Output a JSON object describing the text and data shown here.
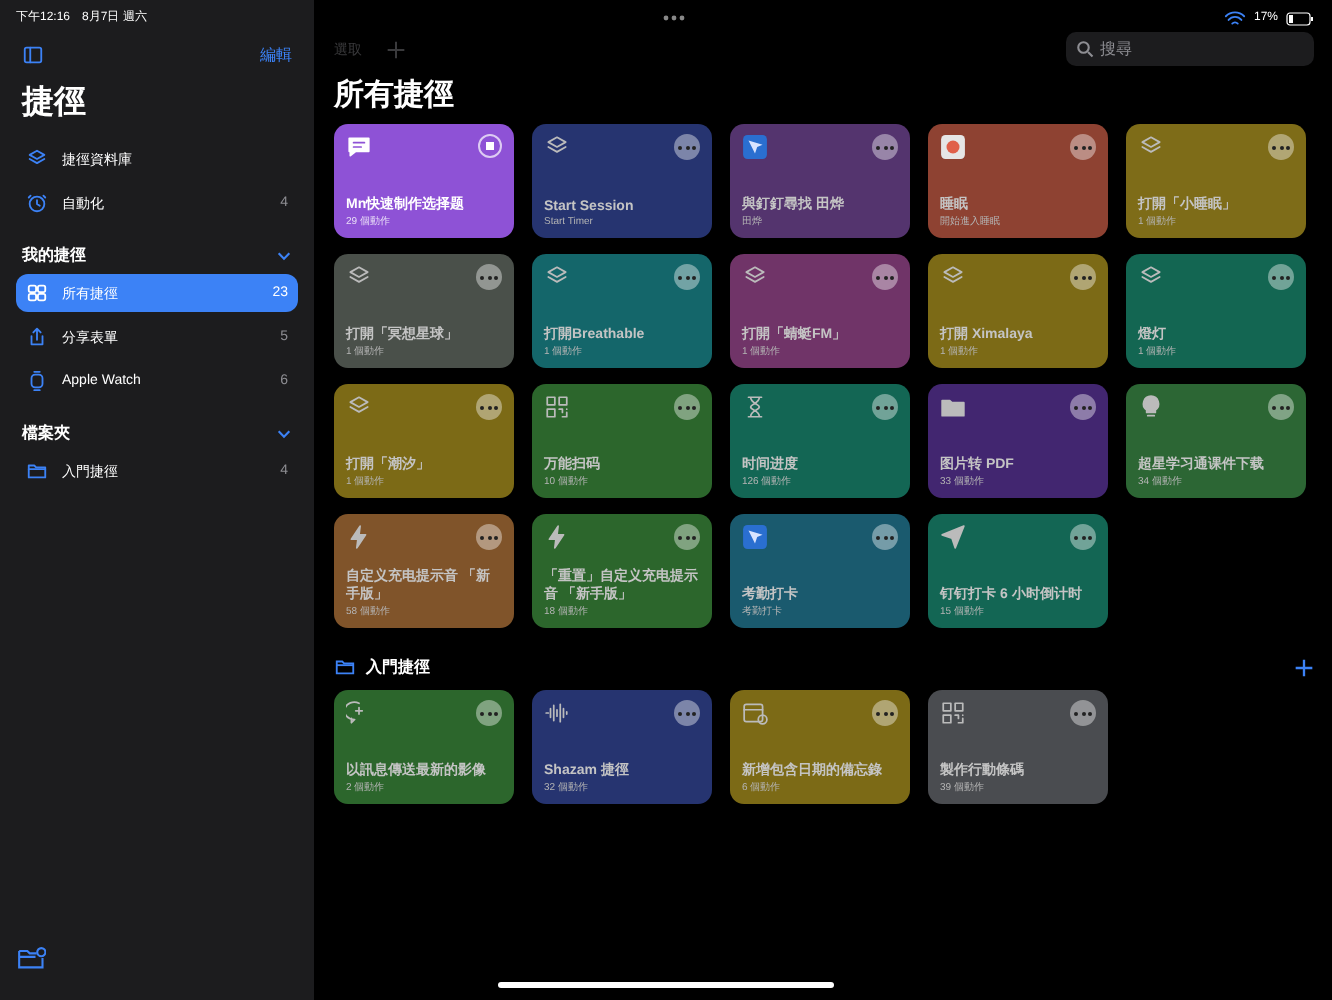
{
  "status_bar": {
    "time": "下午12:16",
    "date": "8月7日 週六",
    "battery": "17%"
  },
  "sidebar": {
    "edit": "編輯",
    "title": "捷徑",
    "top_items": [
      {
        "kind": "gallery",
        "label": "捷徑資料庫",
        "selected": false
      },
      {
        "kind": "automation",
        "label": "自動化",
        "count": "4",
        "selected": false
      }
    ],
    "sections": [
      {
        "title": "我的捷徑",
        "expanded": true,
        "items": [
          {
            "kind": "grid",
            "label": "所有捷徑",
            "count": "23",
            "selected": true
          },
          {
            "kind": "share",
            "label": "分享表單",
            "count": "5",
            "selected": false
          },
          {
            "kind": "watch",
            "label": "Apple Watch",
            "count": "6",
            "selected": false
          }
        ]
      },
      {
        "title": "檔案夾",
        "expanded": true,
        "items": [
          {
            "kind": "folder",
            "label": "入門捷徑",
            "count": "4",
            "selected": false
          }
        ]
      }
    ]
  },
  "toolbar": {
    "select": "選取",
    "search": {
      "placeholder": "搜尋"
    }
  },
  "title": "所有捷徑",
  "shortcuts": [
    {
      "kind": "chat",
      "name": "Mn快速制作选择题",
      "subtitle": "29 個動作",
      "color": "#8e52d6",
      "running": true
    },
    {
      "kind": "layers",
      "name": "Start Session",
      "subtitle": "Start Timer",
      "color": "#263470",
      "running": false
    },
    {
      "kind": "app",
      "name": "與釘釘尋找 田烨",
      "subtitle": "田烨",
      "color": "#54346e",
      "running": false
    },
    {
      "kind": "app2",
      "name": "睡眠",
      "subtitle": "開始進入睡眠",
      "color": "#8e4232",
      "running": false
    },
    {
      "kind": "layers",
      "name": "打開「小睡眠」",
      "subtitle": "1 個動作",
      "color": "#7e6c18",
      "running": false
    },
    {
      "kind": "layers",
      "name": "打開「冥想星球」",
      "subtitle": "1 個動作",
      "color": "#4a504a",
      "running": false
    },
    {
      "kind": "layers",
      "name": "打開Breathable",
      "subtitle": "1 個動作",
      "color": "#14666a",
      "running": false
    },
    {
      "kind": "layers",
      "name": "打開「蜻蜓FM」",
      "subtitle": "1 個動作",
      "color": "#703468",
      "running": false
    },
    {
      "kind": "layers",
      "name": "打開 Ximalaya",
      "subtitle": "1 個動作",
      "color": "#7c6a16",
      "running": false
    },
    {
      "kind": "layers",
      "name": "燈灯",
      "subtitle": "1 個動作",
      "color": "#136652",
      "running": false
    },
    {
      "kind": "layers",
      "name": "打開「潮汐」",
      "subtitle": "1 個動作",
      "color": "#7c6a16",
      "running": false
    },
    {
      "kind": "qr",
      "name": "万能扫码",
      "subtitle": "10 個動作",
      "color": "#2c662c",
      "running": false
    },
    {
      "kind": "hourglass",
      "name": "时间进度",
      "subtitle": "126 個動作",
      "color": "#136654",
      "running": false
    },
    {
      "kind": "folder",
      "name": "图片转 PDF",
      "subtitle": "33 個動作",
      "color": "#422670",
      "running": false
    },
    {
      "kind": "bulb",
      "name": "超星学习通课件下载",
      "subtitle": "34 個動作",
      "color": "#2c6634",
      "running": false
    },
    {
      "kind": "bolt",
      "name": "自定义充电提示音 「新手版」",
      "subtitle": "58 個動作",
      "color": "#80542a",
      "running": false
    },
    {
      "kind": "bolt",
      "name": "「重置」自定义充电提示音 「新手版」",
      "subtitle": "18 個動作",
      "color": "#2c662c",
      "running": false
    },
    {
      "kind": "app",
      "name": "考勤打卡",
      "subtitle": "考勤打卡",
      "color": "#1a5a6e",
      "running": false
    },
    {
      "kind": "send",
      "name": "钉钉打卡 6 小时倒计时",
      "subtitle": "15 個動作",
      "color": "#136654",
      "running": false
    }
  ],
  "folder_section": {
    "title": "入門捷徑",
    "shortcuts": [
      {
        "kind": "chatplus",
        "name": "以訊息傳送最新的影像",
        "subtitle": "2 個動作",
        "color": "#2c662c",
        "running": false
      },
      {
        "kind": "wave",
        "name": "Shazam 捷徑",
        "subtitle": "32 個動作",
        "color": "#263470",
        "running": false
      },
      {
        "kind": "calendar",
        "name": "新增包含日期的備忘錄",
        "subtitle": "6 個動作",
        "color": "#7c6a16",
        "running": false
      },
      {
        "kind": "qr",
        "name": "製作行動條碼",
        "subtitle": "39 個動作",
        "color": "#4a4c50",
        "running": false
      }
    ]
  }
}
